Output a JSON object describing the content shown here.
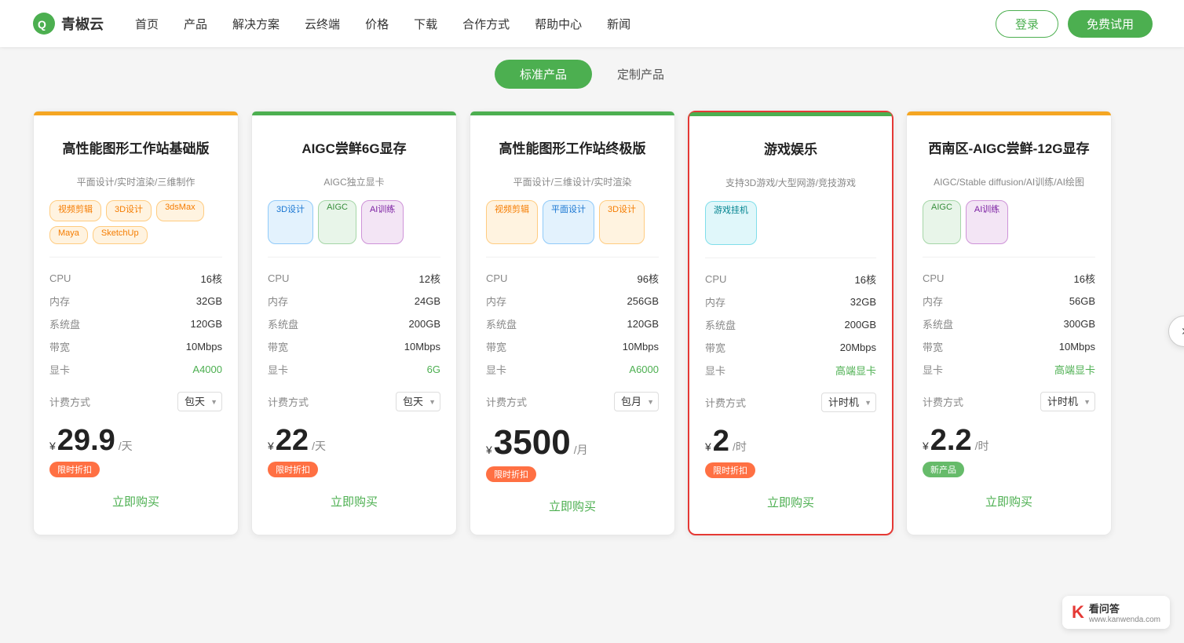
{
  "header": {
    "logo_text": "青椒云",
    "nav_items": [
      "首页",
      "产品",
      "解决方案",
      "云终端",
      "价格",
      "下载",
      "合作方式",
      "帮助中心",
      "新闻"
    ],
    "btn_login": "登录",
    "btn_trial": "免费试用"
  },
  "tabs": [
    {
      "label": "标准产品",
      "active": true
    },
    {
      "label": "定制产品",
      "active": false
    }
  ],
  "cards": [
    {
      "id": "card1",
      "border_color": "#f5a623",
      "title": "高性能图形工作站基础版",
      "subtitle": "平面设计/实时渲染/三维制作",
      "tags": [
        {
          "label": "视频剪辑",
          "type": "orange"
        },
        {
          "label": "3D设计",
          "type": "orange"
        },
        {
          "label": "3dsMax",
          "type": "orange"
        },
        {
          "label": "Maya",
          "type": "orange"
        },
        {
          "label": "SketchUp",
          "type": "orange"
        }
      ],
      "specs": [
        {
          "label": "CPU",
          "value": "16核",
          "green": false
        },
        {
          "label": "内存",
          "value": "32GB",
          "green": false
        },
        {
          "label": "系统盘",
          "value": "120GB",
          "green": false
        },
        {
          "label": "带宽",
          "value": "10Mbps",
          "green": false
        },
        {
          "label": "显卡",
          "value": "A4000",
          "green": true
        }
      ],
      "billing_label": "计费方式",
      "billing_value": "包天",
      "price_symbol": "¥",
      "price_number": "29.9",
      "price_unit": "/天",
      "badge": "限时折扣",
      "badge_type": "orange",
      "buy_label": "立即购买",
      "highlighted": false
    },
    {
      "id": "card2",
      "border_color": "#4caf50",
      "title": "AIGC尝鲜6G显存",
      "subtitle": "AIGC独立显卡",
      "tags": [
        {
          "label": "3D设计",
          "type": "blue"
        },
        {
          "label": "AIGC",
          "type": "green"
        },
        {
          "label": "AI训练",
          "type": "purple"
        }
      ],
      "specs": [
        {
          "label": "CPU",
          "value": "12核",
          "green": false
        },
        {
          "label": "内存",
          "value": "24GB",
          "green": false
        },
        {
          "label": "系统盘",
          "value": "200GB",
          "green": false
        },
        {
          "label": "带宽",
          "value": "10Mbps",
          "green": false
        },
        {
          "label": "显卡",
          "value": "6G",
          "green": true
        }
      ],
      "billing_label": "计费方式",
      "billing_value": "包天",
      "price_symbol": "¥",
      "price_number": "22",
      "price_unit": "/天",
      "badge": "限时折扣",
      "badge_type": "orange",
      "buy_label": "立即购买",
      "highlighted": false
    },
    {
      "id": "card3",
      "border_color": "#4caf50",
      "title": "高性能图形工作站终极版",
      "subtitle": "平面设计/三维设计/实时渲染",
      "tags": [
        {
          "label": "视频剪辑",
          "type": "orange"
        },
        {
          "label": "平面设计",
          "type": "blue"
        },
        {
          "label": "3D设计",
          "type": "orange"
        }
      ],
      "specs": [
        {
          "label": "CPU",
          "value": "96核",
          "green": false
        },
        {
          "label": "内存",
          "value": "256GB",
          "green": false
        },
        {
          "label": "系统盘",
          "value": "120GB",
          "green": false
        },
        {
          "label": "带宽",
          "value": "10Mbps",
          "green": false
        },
        {
          "label": "显卡",
          "value": "A6000",
          "green": true
        }
      ],
      "billing_label": "计费方式",
      "billing_value": "包月",
      "price_symbol": "¥",
      "price_number": "3500",
      "price_unit": "/月",
      "badge": "限时折扣",
      "badge_type": "orange",
      "buy_label": "立即购买",
      "highlighted": false
    },
    {
      "id": "card4",
      "border_color": "#4caf50",
      "title": "游戏娱乐",
      "subtitle": "支持3D游戏/大型网游/竞技游戏",
      "tags": [
        {
          "label": "游戏挂机",
          "type": "teal"
        }
      ],
      "specs": [
        {
          "label": "CPU",
          "value": "16核",
          "green": false
        },
        {
          "label": "内存",
          "value": "32GB",
          "green": false
        },
        {
          "label": "系统盘",
          "value": "200GB",
          "green": false
        },
        {
          "label": "带宽",
          "value": "20Mbps",
          "green": false
        },
        {
          "label": "显卡",
          "value": "高端显卡",
          "green": true
        }
      ],
      "billing_label": "计费方式",
      "billing_value": "计时机",
      "price_symbol": "¥",
      "price_number": "2",
      "price_unit": "/时",
      "badge": "限时折扣",
      "badge_type": "orange",
      "buy_label": "立即购买",
      "highlighted": true
    },
    {
      "id": "card5",
      "border_color": "#f5a623",
      "title": "西南区-AIGC尝鲜-12G显存",
      "subtitle": "AIGC/Stable diffusion/AI训练/AI绘图",
      "tags": [
        {
          "label": "AIGC",
          "type": "green"
        },
        {
          "label": "AI训练",
          "type": "purple"
        }
      ],
      "specs": [
        {
          "label": "CPU",
          "value": "16核",
          "green": false
        },
        {
          "label": "内存",
          "value": "56GB",
          "green": false
        },
        {
          "label": "系统盘",
          "value": "300GB",
          "green": false
        },
        {
          "label": "带宽",
          "value": "10Mbps",
          "green": false
        },
        {
          "label": "显卡",
          "value": "高端显卡",
          "green": true
        }
      ],
      "billing_label": "计费方式",
      "billing_value": "计时机",
      "price_symbol": "¥",
      "price_number": "2.2",
      "price_unit": "/时",
      "badge": "新产品",
      "badge_type": "new",
      "buy_label": "立即购买",
      "highlighted": false
    }
  ],
  "next_arrow": "›",
  "watermark": {
    "logo": "K",
    "site": "看问答",
    "url": "www.kanwenda.com"
  }
}
